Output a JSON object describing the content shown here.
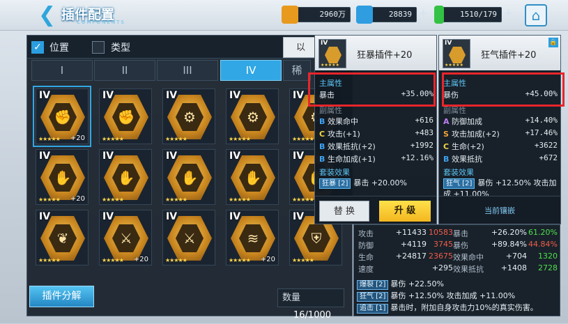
{
  "header": {
    "title": "插件配置",
    "subtitle": "COMPONENTS"
  },
  "resources": [
    {
      "name": "gold",
      "value": "2960万",
      "color": "#e89a1f"
    },
    {
      "name": "crystal",
      "value": "28839",
      "color": "#2f9de0"
    },
    {
      "name": "stamina",
      "value": "1510/179",
      "color": "#34c244"
    }
  ],
  "filter": {
    "position_label": "位置",
    "type_label": "类型",
    "sort_label": "以"
  },
  "tabs": [
    "I",
    "II",
    "III",
    "IV",
    "稀"
  ],
  "grid": [
    {
      "rank": "IV",
      "icon": "fist",
      "lvl": "+20"
    },
    {
      "rank": "IV",
      "icon": "fist",
      "lvl": ""
    },
    {
      "rank": "IV",
      "icon": "gear",
      "lvl": ""
    },
    {
      "rank": "IV",
      "icon": "gear",
      "lvl": ""
    },
    {
      "rank": "IV",
      "icon": "gear",
      "lvl": ""
    },
    {
      "rank": "IV",
      "icon": "hand",
      "lvl": "+20"
    },
    {
      "rank": "IV",
      "icon": "hand",
      "lvl": ""
    },
    {
      "rank": "IV",
      "icon": "hand",
      "lvl": ""
    },
    {
      "rank": "IV",
      "icon": "hand",
      "lvl": ""
    },
    {
      "rank": "IV",
      "icon": "hand",
      "lvl": ""
    },
    {
      "rank": "IV",
      "icon": "wings",
      "lvl": ""
    },
    {
      "rank": "IV",
      "icon": "sword",
      "lvl": "+20"
    },
    {
      "rank": "IV",
      "icon": "sword",
      "lvl": ""
    },
    {
      "rank": "IV",
      "icon": "claw",
      "lvl": "+20"
    },
    {
      "rank": "IV",
      "icon": "shield",
      "lvl": ""
    }
  ],
  "stars": "★★★★★",
  "decompose_label": "插件分解",
  "quantity": {
    "label": "数量",
    "value": "16/1000"
  },
  "popup_left": {
    "rank": "IV",
    "name": "狂暴插件+20",
    "main_label": "主属性",
    "main_key": "暴击",
    "main_val": "+35.00%",
    "sub_label": "副属性",
    "subs": [
      {
        "tag": "B",
        "key": "效果命中",
        "val": "+616"
      },
      {
        "tag": "C",
        "key": "攻击(+1)",
        "val": "+483"
      },
      {
        "tag": "B",
        "key": "效果抵抗(+2)",
        "val": "+1992"
      },
      {
        "tag": "B",
        "key": "生命加成(+1)",
        "val": "+12.16%"
      }
    ],
    "set_label": "套装效果",
    "set_chip": "狂暴 [2]",
    "set_text": "暴击 +20.00%",
    "swap": "替 换",
    "upgrade": "升 级"
  },
  "popup_right": {
    "rank": "IV",
    "name": "狂气插件+20",
    "main_label": "主属性",
    "main_key": "暴伤",
    "main_val": "+45.00%",
    "sub_label": "副属性",
    "subs": [
      {
        "tag": "A",
        "key": "防御加成",
        "val": "+14.40%"
      },
      {
        "tag": "S",
        "key": "攻击加成(+2)",
        "val": "+17.46%"
      },
      {
        "tag": "C",
        "key": "生命(+2)",
        "val": "+3622"
      },
      {
        "tag": "B",
        "key": "效果抵抗",
        "val": "+672"
      }
    ],
    "set_label": "套装效果",
    "set_chip": "狂气 [2]",
    "set_text": "暴伤 +12.50% 攻击加成 +11.00%",
    "equipped": "当前镶嵌"
  },
  "stats": {
    "rows": [
      {
        "k1": "攻击",
        "v1": "+11433",
        "d1": "10583",
        "k2": "暴击",
        "v2": "+26.20%",
        "d2": "61.20%",
        "dir2": "up"
      },
      {
        "k1": "防御",
        "v1": "+4119",
        "d1": "3745",
        "k2": "暴伤",
        "v2": "+89.84%",
        "d2": "44.84%",
        "dir2": "down"
      },
      {
        "k1": "生命",
        "v1": "+24817",
        "d1": "23675",
        "k2": "效果命中",
        "v2": "+704",
        "d2": "1320",
        "dir2": "up"
      },
      {
        "k1": "速度",
        "v1": "+295",
        "d1": "",
        "k2": "效果抵抗",
        "v2": "+1408",
        "d2": "2728",
        "dir2": "up"
      }
    ],
    "bonuses": [
      {
        "chip": "爆裂 [2]",
        "text": "暴伤 +22.50%"
      },
      {
        "chip": "狂气 [2]",
        "text": "暴伤 +12.50% 攻击加成 +11.00%"
      },
      {
        "chip": "追击 [1]",
        "text": "暴击时，附加自身攻击力10%的真实伤害。"
      }
    ]
  }
}
